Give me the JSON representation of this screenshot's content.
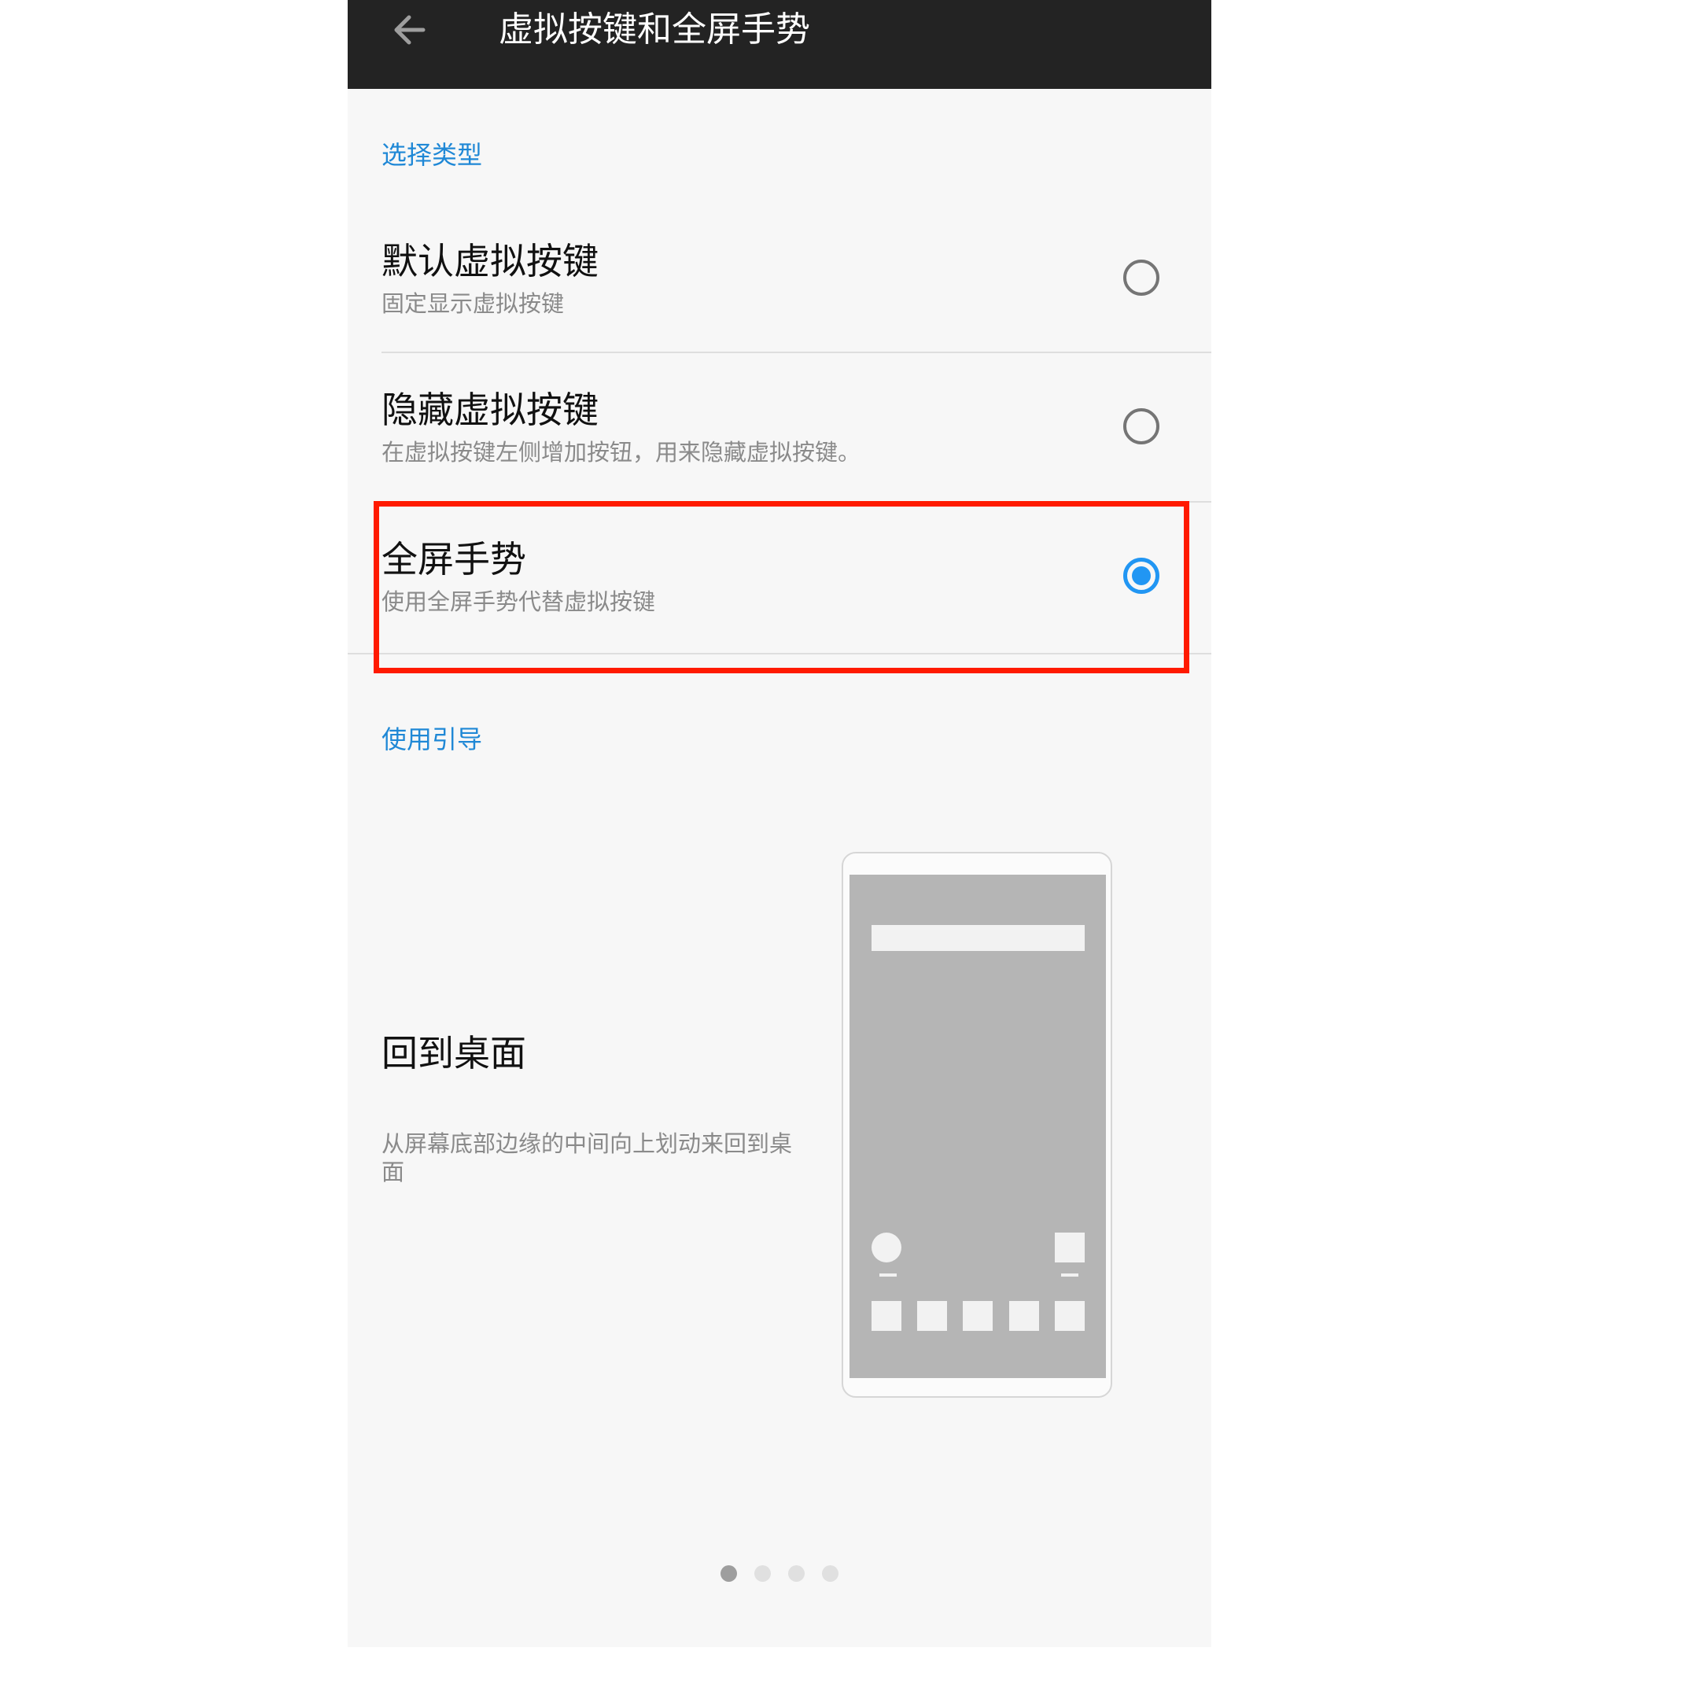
{
  "header": {
    "title": "虚拟按键和全屏手势",
    "back_icon": "arrow-left-icon"
  },
  "select_type": {
    "section_label": "选择类型",
    "options": [
      {
        "title": "默认虚拟按键",
        "subtitle": "固定显示虚拟按键",
        "selected": false
      },
      {
        "title": "隐藏虚拟按键",
        "subtitle": "在虚拟按键左侧增加按钮，用来隐藏虚拟按键。",
        "selected": false
      },
      {
        "title": "全屏手势",
        "subtitle": "使用全屏手势代替虚拟按键",
        "selected": true
      }
    ]
  },
  "guide": {
    "section_label": "使用引导",
    "slide_title": "回到桌面",
    "slide_description": "从屏幕底部边缘的中间向上划动来回到桌面",
    "pager": {
      "count": 4,
      "active_index": 0
    }
  },
  "colors": {
    "accent": "#2196f3",
    "section_label": "#1f88d6",
    "highlight_box": "#ff1a00",
    "app_bar": "#232323"
  }
}
